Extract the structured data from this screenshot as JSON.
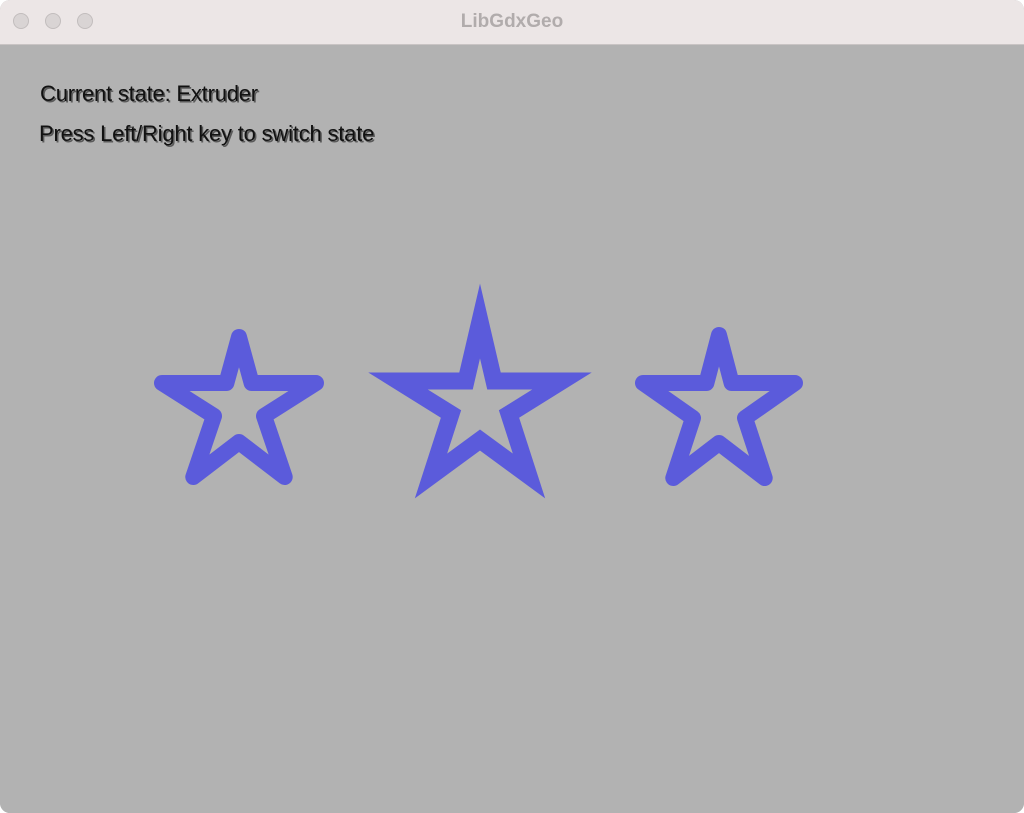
{
  "window": {
    "title": "LibGdxGeo",
    "buttons": [
      "close-button",
      "minimize-button",
      "zoom-button"
    ]
  },
  "hud": {
    "state_text": "Current state: Extruder",
    "hint_text": "Press Left/Right key to switch state"
  },
  "scene": {
    "background_color": "#b2b2b2",
    "stroke_color": "#5b5bdb",
    "shapes": [
      {
        "name": "star-shape-left",
        "kind": "outlined-star",
        "join": "round"
      },
      {
        "name": "star-shape-center",
        "kind": "outlined-star",
        "join": "miter"
      },
      {
        "name": "star-shape-right",
        "kind": "outlined-star",
        "join": "round"
      }
    ]
  }
}
